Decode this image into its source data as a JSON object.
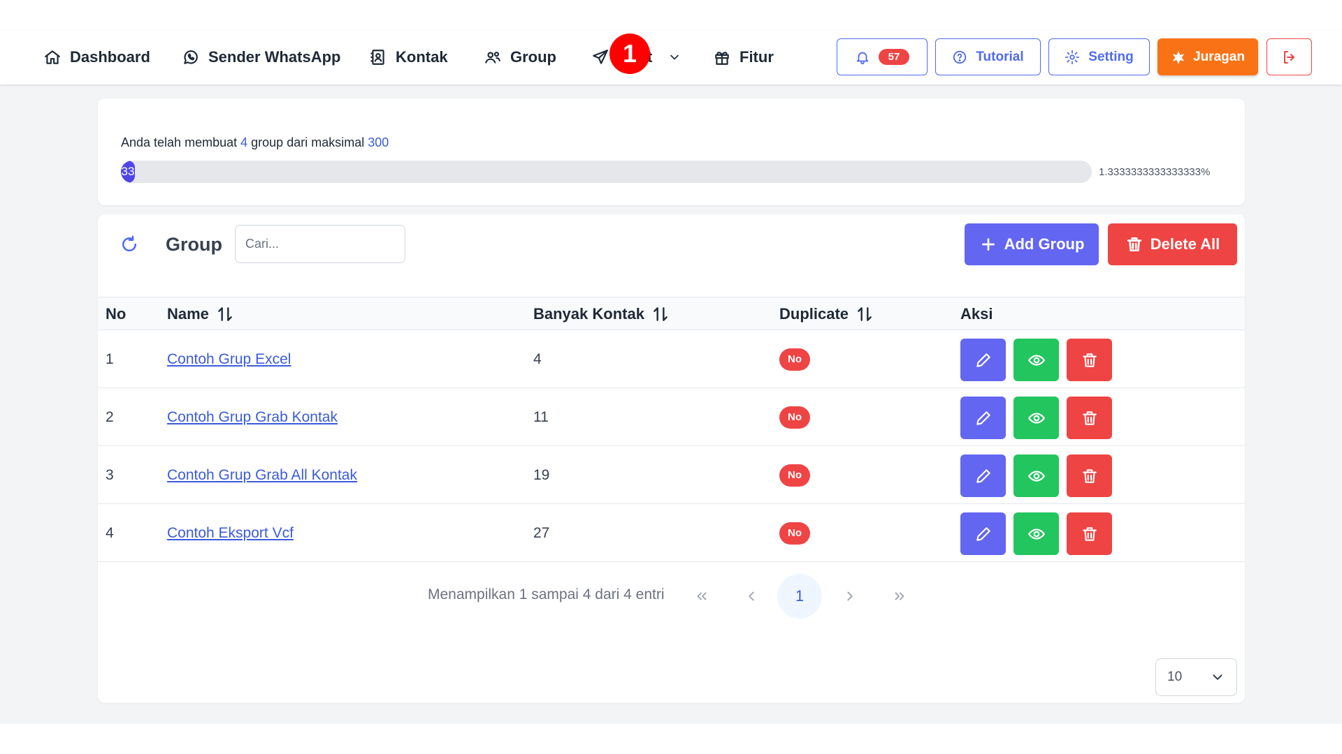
{
  "nav": {
    "items": [
      {
        "label": "Dashboard",
        "icon": "home-icon"
      },
      {
        "label": "Sender WhatsApp",
        "icon": "whatsapp-icon"
      },
      {
        "label": "Kontak",
        "icon": "contact-book-icon"
      },
      {
        "label": "Group",
        "icon": "users-icon"
      },
      {
        "label": "t",
        "icon": "send-icon"
      },
      {
        "label": "Fitur",
        "icon": "gift-icon"
      }
    ],
    "step_marker": "1",
    "notification_count": "57",
    "tutorial_label": "Tutorial",
    "setting_label": "Setting",
    "juragan_label": "Juragan"
  },
  "quota": {
    "prefix": "Anda telah membuat",
    "count": "4",
    "middle": "group dari maksimal",
    "max": "300",
    "bar_text": "33",
    "percent_text": "1.3333333333333333%",
    "percent_value": 1.3333333333333333
  },
  "group_card": {
    "title": "Group",
    "search_placeholder": "Cari...",
    "add_label": "Add Group",
    "delete_all_label": "Delete All"
  },
  "table": {
    "headers": {
      "no": "No",
      "name": "Name",
      "count": "Banyak Kontak",
      "duplicate": "Duplicate",
      "action": "Aksi"
    },
    "rows": [
      {
        "no": "1",
        "name": "Contoh Grup Excel",
        "count": "4",
        "duplicate": "No"
      },
      {
        "no": "2",
        "name": "Contoh Grup Grab Kontak",
        "count": "11",
        "duplicate": "No"
      },
      {
        "no": "3",
        "name": "Contoh Grup Grab All Kontak",
        "count": "19",
        "duplicate": "No"
      },
      {
        "no": "4",
        "name": "Contoh Eksport Vcf",
        "count": "27",
        "duplicate": "No"
      }
    ]
  },
  "pagination": {
    "info": "Menampilkan 1 sampai 4 dari 4 entri",
    "current_page": "1",
    "per_page": "10"
  },
  "colors": {
    "primary": "#6366f1",
    "success": "#22c55e",
    "danger": "#ef4444",
    "accent_orange": "#f97316",
    "link": "#3b5bdb"
  }
}
